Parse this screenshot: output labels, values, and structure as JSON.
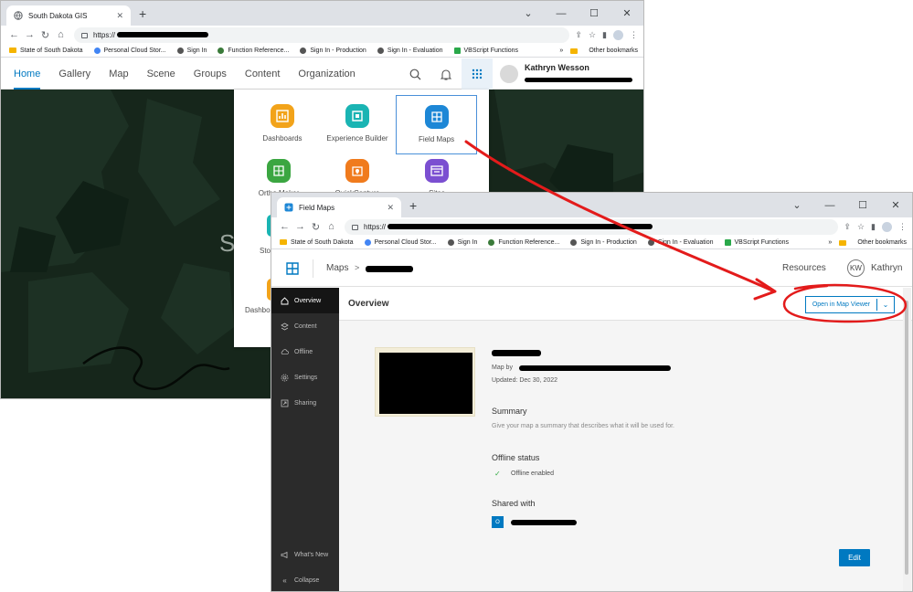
{
  "window1": {
    "tab_title": "South Dakota GIS",
    "url": "https://",
    "bookmarks": [
      "State of South Dakota",
      "Personal Cloud Stor...",
      "Sign In",
      "Function Reference...",
      "Sign In - Production",
      "Sign In - Evaluation",
      "VBScript Functions"
    ],
    "bookmarks_more": "»",
    "other_bookmarks": "Other bookmarks",
    "nav": [
      "Home",
      "Gallery",
      "Map",
      "Scene",
      "Groups",
      "Content",
      "Organization"
    ],
    "user_name": "Kathryn Wesson",
    "hero_letter": "S",
    "apps": [
      {
        "label": "Dashboards",
        "color": "#f2a31a",
        "icon": "dashboards-icon"
      },
      {
        "label": "Experience Builder",
        "color": "#1ab4b3",
        "icon": "experience-builder-icon"
      },
      {
        "label": "Field Maps",
        "color": "#1d87d6",
        "icon": "field-maps-icon"
      },
      {
        "label": "Ortho Maker",
        "color": "#3ba641",
        "icon": "ortho-maker-icon"
      },
      {
        "label": "QuickCapture",
        "color": "#f07b1d",
        "icon": "quickcapture-icon"
      },
      {
        "label": "Sites",
        "color": "#7b4fd1",
        "icon": "sites-icon"
      }
    ],
    "partial_labels": [
      "Sto",
      "Dashbo"
    ]
  },
  "window2": {
    "tab_title": "Field Maps",
    "url": "https://",
    "bookmarks": [
      "State of South Dakota",
      "Personal Cloud Stor...",
      "Sign In",
      "Function Reference...",
      "Sign In - Production",
      "Sign In - Evaluation",
      "VBScript Functions"
    ],
    "bookmarks_more": "»",
    "other_bookmarks": "Other bookmarks",
    "breadcrumb_root": "Maps",
    "breadcrumb_sep": ">",
    "resources": "Resources",
    "avatar_initials": "KW",
    "user_first": "Kathryn",
    "sidebar": [
      "Overview",
      "Content",
      "Offline",
      "Settings",
      "Sharing"
    ],
    "sidebar_bottom": [
      "What's New",
      "Collapse"
    ],
    "page_title": "Overview",
    "open_button": "Open in Map Viewer",
    "map_by": "Map by",
    "updated": "Updated: Dec 30, 2022",
    "summary_title": "Summary",
    "summary_text": "Give your map a summary that describes what it will be used for.",
    "offline_title": "Offline status",
    "offline_text": "Offline enabled",
    "shared_title": "Shared with",
    "shared_badge": "O",
    "edit_button": "Edit"
  },
  "annotation_color": "#e31b1b"
}
